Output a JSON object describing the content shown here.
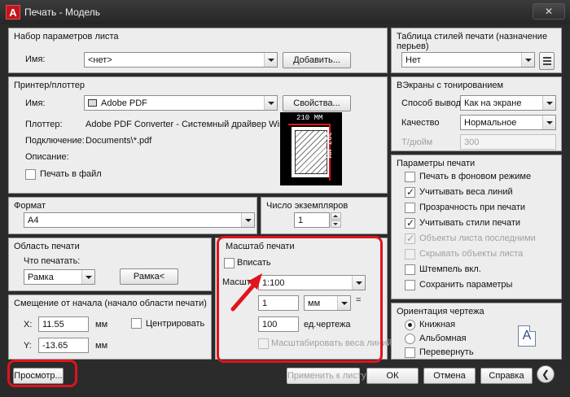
{
  "window": {
    "title": "Печать - Модель",
    "app_icon_letter": "A",
    "close_glyph": "✕"
  },
  "page_setup": {
    "title": "Набор параметров листа",
    "name_label": "Имя:",
    "name_value": "<нет>",
    "add_button": "Добавить..."
  },
  "printer": {
    "title": "Принтер/плоттер",
    "name_label": "Имя:",
    "name_value": "Adobe PDF",
    "properties_button": "Свойства...",
    "plotter_label": "Плоттер:",
    "plotter_value": "Adobe PDF Converter - Системный драйвер Windo...",
    "connection_label": "Подключение:",
    "connection_value": "Documents\\*.pdf",
    "description_label": "Описание:",
    "print_to_file_label": "Печать в файл",
    "print_to_file_checked": false,
    "preview_width": "210 MM",
    "preview_height": "297 MM"
  },
  "paper": {
    "title": "Формат",
    "value": "A4"
  },
  "copies": {
    "title": "Число экземпляров",
    "value": "1"
  },
  "area": {
    "title": "Область печати",
    "what_label": "Что печатать:",
    "what_value": "Рамка",
    "frame_button": "Рамка<"
  },
  "offset": {
    "title": "Смещение от начала (начало области печати)",
    "x_label": "X:",
    "x_value": "11.55",
    "x_unit": "мм",
    "y_label": "Y:",
    "y_value": "-13.65",
    "y_unit": "мм",
    "center_label": "Центрировать",
    "center_checked": false
  },
  "scale": {
    "title": "Масштаб печати",
    "fit_label": "Вписать",
    "fit_checked": false,
    "scale_label": "Масштаб:",
    "scale_value": "1:100",
    "value1": "1",
    "unit_value": "мм",
    "equals": "=",
    "value2": "100",
    "unit2_label": "ед.чертежа",
    "lineweights_label": "Масштабировать веса линий",
    "lineweights_checked": false
  },
  "style_table": {
    "title": "Таблица стилей печати (назначение перьев)",
    "value": "Нет"
  },
  "shaded": {
    "title": "ВЭкраны с тонированием",
    "output_label": "Способ вывода",
    "output_value": "Как на экране",
    "quality_label": "Качество",
    "quality_value": "Нормальное",
    "dpi_label": "Т/дюйм",
    "dpi_value": "300"
  },
  "print_options": {
    "title": "Параметры печати",
    "items": [
      {
        "label": "Печать в фоновом режиме",
        "checked": false,
        "disabled": false
      },
      {
        "label": "Учитывать веса линий",
        "checked": true,
        "disabled": false
      },
      {
        "label": "Прозрачность при печати",
        "checked": false,
        "disabled": false
      },
      {
        "label": "Учитывать стили печати",
        "checked": true,
        "disabled": false
      },
      {
        "label": "Объекты листа последними",
        "checked": true,
        "disabled": true
      },
      {
        "label": "Скрывать объекты листа",
        "checked": false,
        "disabled": true
      },
      {
        "label": "Штемпель вкл.",
        "checked": false,
        "disabled": false
      },
      {
        "label": "Сохранить параметры",
        "checked": false,
        "disabled": false
      }
    ]
  },
  "orientation": {
    "title": "Ориентация чертежа",
    "portrait": "Книжная",
    "landscape": "Альбомная",
    "upside_down": "Перевернуть",
    "selected": "portrait",
    "icon_letter": "A"
  },
  "footer": {
    "preview_button": "Просмотр...",
    "apply_button": "Применить к листу",
    "ok_button": "ОК",
    "cancel_button": "Отмена",
    "help_button": "Справка",
    "expand_glyph": "❮"
  },
  "colors": {
    "highlight": "#e0141b",
    "panel_bg": "#ededed",
    "frame_bg": "#2b2b2b"
  }
}
